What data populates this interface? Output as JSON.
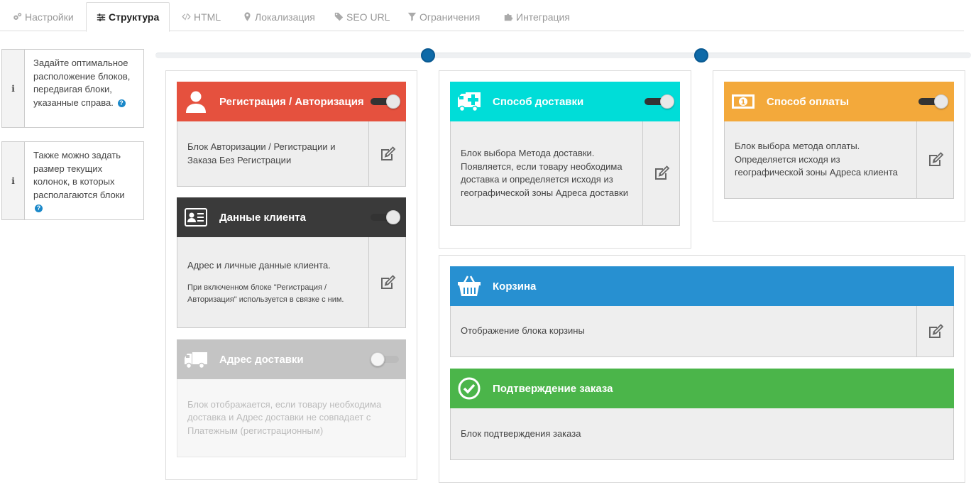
{
  "tabs": [
    {
      "label": "Настройки",
      "icon": "gears-icon",
      "active": false
    },
    {
      "label": "Структура",
      "icon": "sliders-icon",
      "active": true
    },
    {
      "label": "HTML",
      "icon": "code-icon",
      "active": false
    },
    {
      "label": "Локализация",
      "icon": "map-marker-icon",
      "active": false
    },
    {
      "label": "SEO URL",
      "icon": "tags-icon",
      "active": false
    },
    {
      "label": "Ограничения",
      "icon": "filter-icon",
      "active": false
    },
    {
      "label": "Интеграция",
      "icon": "puzzle-icon",
      "active": false
    }
  ],
  "info": [
    {
      "icon": "info-icon",
      "text": "Задайте оптимальное расположение блоков, передвигая блоки, указанные справа."
    },
    {
      "icon": "info-icon",
      "text": "Также можно задать размер текущих колонок, в которых располагаются блоки"
    }
  ],
  "blocks": {
    "auth": {
      "title": "Регистрация / Авторизация",
      "desc": "Блок Авторизации / Регистрации и Заказа Без Регистрации",
      "enabled": true,
      "color": "#e5513e"
    },
    "customer": {
      "title": "Данные клиента",
      "desc": "Адрес и личные данные клиента.",
      "note": "При включенном блоке \"Регистрация / Авторизация\" используется в связке с ним.",
      "enabled": true,
      "color": "#3a3a3a"
    },
    "address": {
      "title": "Адрес доставки",
      "desc": "Блок отображается, если товару необходима доставка и Адрес доставки не совпадает с Платежным (регистрационным)",
      "enabled": false,
      "color": "#c4c4c4"
    },
    "shipping": {
      "title": "Способ доставки",
      "desc": "Блок выбора Метода доставки. Появляется, если товару необходима доставка и определяется исходя из географической зоны Адреса доставки",
      "enabled": true,
      "color": "#00ddd8"
    },
    "payment": {
      "title": "Способ оплаты",
      "desc": "Блок выбора метода оплаты. Определяется исходя из географической зоны Адреса клиента",
      "enabled": true,
      "color": "#f3a93b"
    },
    "cart": {
      "title": "Корзина",
      "desc": "Отображение блока корзины",
      "color": "#2790d1"
    },
    "confirm": {
      "title": "Подтверждение заказа",
      "desc": "Блок подтверждения заказа",
      "color": "#4bb54a"
    }
  }
}
